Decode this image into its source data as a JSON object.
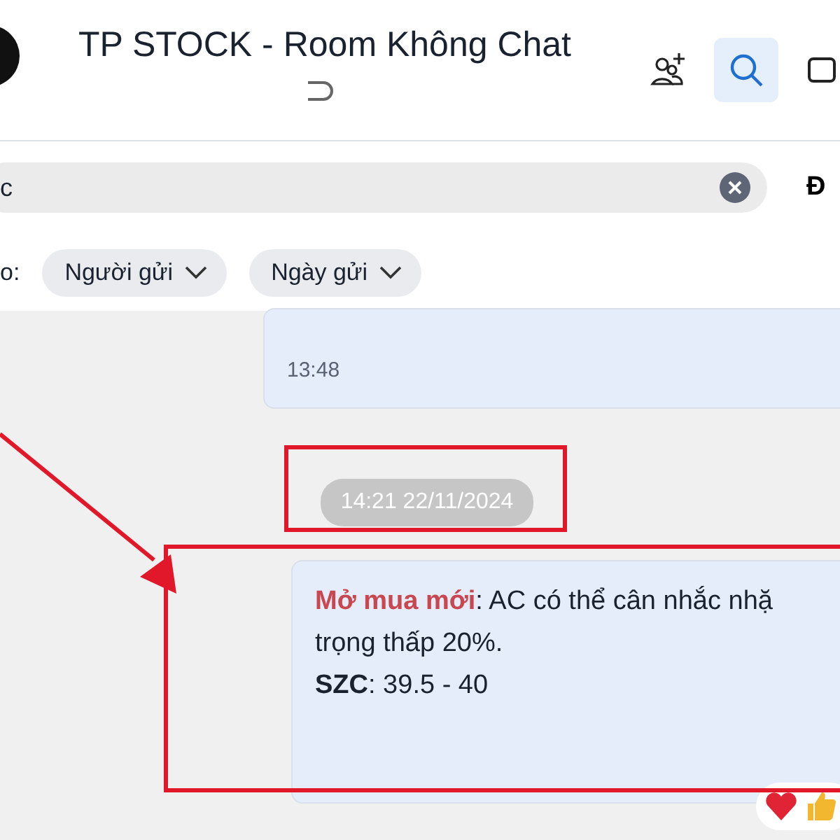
{
  "header": {
    "title": "TP STOCK - Room Không Chat"
  },
  "search": {
    "value": "c",
    "side_button": "Đ"
  },
  "filters": {
    "label": "o:",
    "chips": [
      {
        "label": "Người gửi"
      },
      {
        "label": "Ngày gửi"
      }
    ]
  },
  "earlier_message": {
    "time": "13:48"
  },
  "date_separator": "14:21 22/11/2024",
  "message": {
    "lines": [
      "**Mở mua mới**: AC có thể cân nhắc nhặ",
      "trọng thấp 20%.",
      "**SZC**: 39.5 - 40"
    ]
  }
}
